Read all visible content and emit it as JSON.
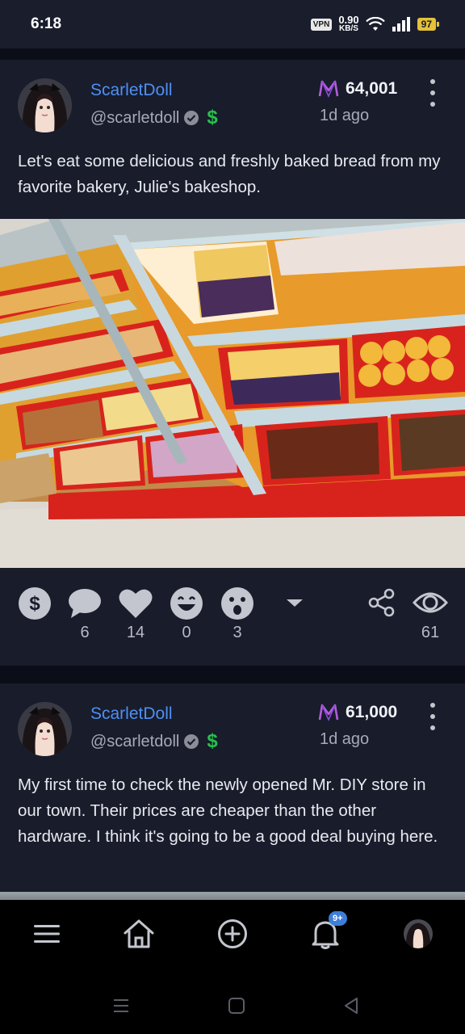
{
  "status_bar": {
    "time": "6:18",
    "vpn": "VPN",
    "net_speed": "0.90",
    "net_unit": "KB/S",
    "battery": "97"
  },
  "posts": [
    {
      "author": "ScarletDoll",
      "handle": "@scarletdoll",
      "score": "64,001",
      "time_ago": "1d ago",
      "text": "Let's eat some delicious and freshly baked bread from my favorite bakery, Julie's bakeshop.",
      "counts": {
        "comments": "6",
        "likes": "14",
        "laugh": "0",
        "wow": "3",
        "views": "61"
      }
    },
    {
      "author": "ScarletDoll",
      "handle": "@scarletdoll",
      "score": "61,000",
      "time_ago": "1d ago",
      "text": "My first time to check the newly opened Mr. DIY store in our town. Their prices are cheaper than the other hardware. I think it's going to be a good deal buying here."
    }
  ],
  "bottom_nav": {
    "notification_badge": "9+"
  },
  "colors": {
    "accent_blue": "#4f8ff2",
    "score_icon": "#b45ce0",
    "dollar_green": "#27c04d"
  },
  "icons": [
    "menu-icon",
    "home-icon",
    "plus-circle-icon",
    "bell-icon",
    "profile-avatar",
    "tip-dollar-icon",
    "comment-icon",
    "heart-icon",
    "laugh-icon",
    "wow-icon",
    "chevron-down-icon",
    "share-icon",
    "eye-icon"
  ]
}
